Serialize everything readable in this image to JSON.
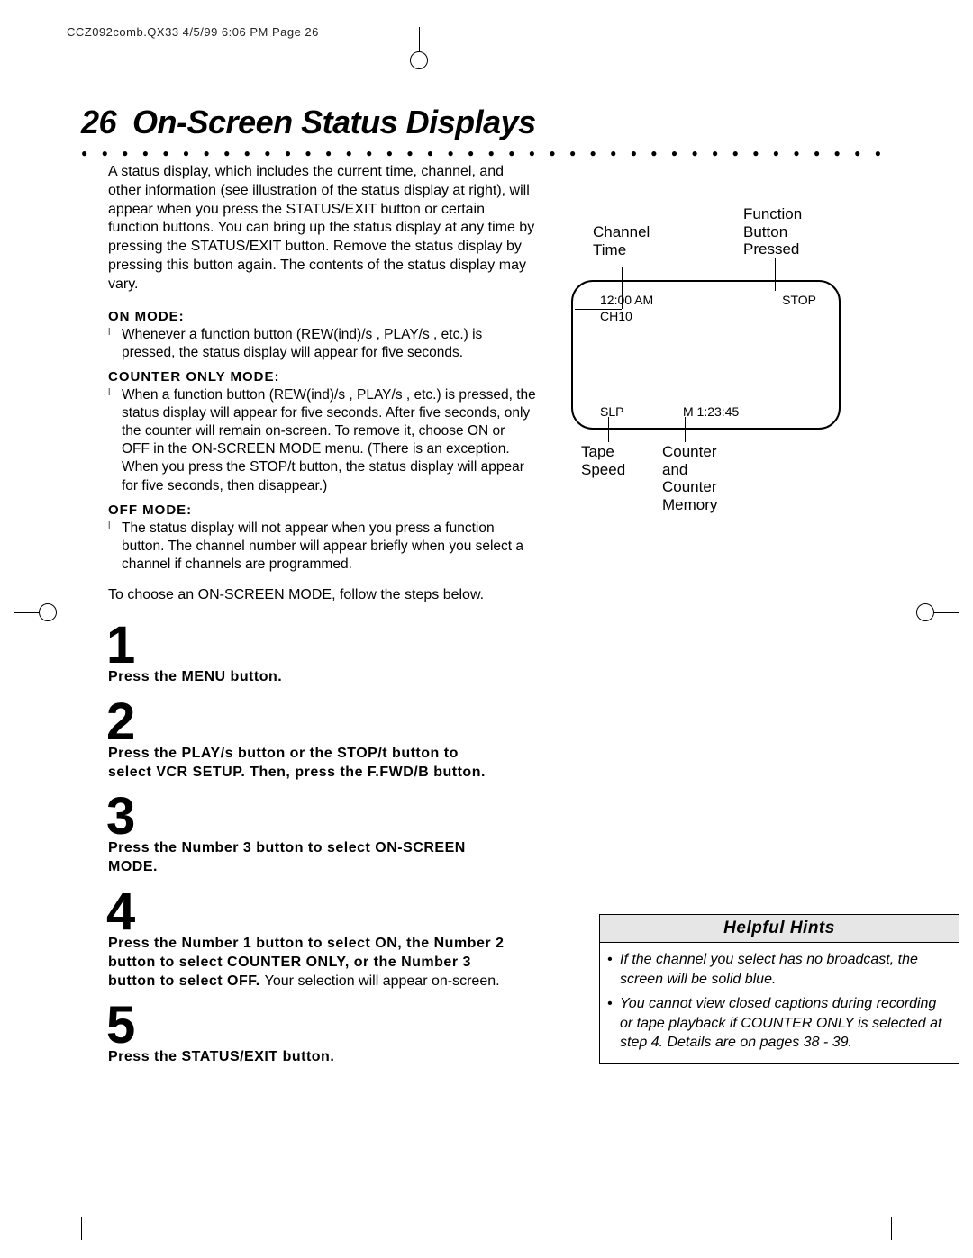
{
  "meta_header": "CCZ092comb.QX33  4/5/99 6:06 PM  Page 26",
  "page_number": "26",
  "title": "On-Screen Status Displays",
  "intro": "A status display, which includes the current time, channel, and other information (see illustration of the status display at right), will appear when you press the STATUS/EXIT button or certain function buttons. You can bring up the status display at any time by pressing the STATUS/EXIT button. Remove the status display by pressing this button again. The contents of the status display may vary.",
  "modes": {
    "on": {
      "h": "ON MODE:",
      "b": "Whenever a function button (REW(ind)/s , PLAY/s , etc.) is pressed, the status display will appear for five seconds."
    },
    "counter": {
      "h": "COUNTER ONLY MODE:",
      "b": "When a function button (REW(ind)/s , PLAY/s , etc.) is pressed, the status display will appear for five seconds. After five seconds, only the counter will remain on-screen. To remove it, choose ON or OFF in the ON-SCREEN MODE menu. (There is an exception. When you press the STOP/t  button, the status display will appear for five seconds, then disappear.)"
    },
    "off": {
      "h": "OFF MODE:",
      "b": "The status display will not appear when you press a function button. The channel number will appear briefly when you select a channel if channels are programmed."
    }
  },
  "follow": "To choose an ON-SCREEN MODE, follow the steps below.",
  "steps": {
    "s1n": "1",
    "s1": "Press the MENU button.",
    "s2n": "2",
    "s2": "Press the PLAY/s  button or the STOP/t  button to select VCR SETUP. Then, press the F.FWD/B  button.",
    "s3n": "3",
    "s3": "Press the Number 3 button to select ON-SCREEN MODE.",
    "s4n": "4",
    "s4b": "Press the Number 1 button to select ON, the Number 2 button to select COUNTER ONLY, or the Number 3 button to select OFF. ",
    "s4r": "Your selection will appear on-screen.",
    "s5n": "5",
    "s5": "Press the STATUS/EXIT button."
  },
  "diagram": {
    "channel_time": "Channel\nTime",
    "function": "Function\nButton\nPressed",
    "tape": "Tape\nSpeed",
    "counter_label": "Counter\nand\nCounter\nMemory",
    "s_time": "12:00 AM",
    "s_stop": "STOP",
    "s_ch": "CH10",
    "s_slp": "SLP",
    "s_mcounter": "M  1:23:45"
  },
  "hints": {
    "h": "Helpful Hints",
    "i1": "If the channel you select has no broadcast, the screen will be solid blue.",
    "i2": "You cannot view closed captions during recording or tape playback if COUNTER ONLY is selected at step 4. Details are on pages 38 - 39."
  }
}
